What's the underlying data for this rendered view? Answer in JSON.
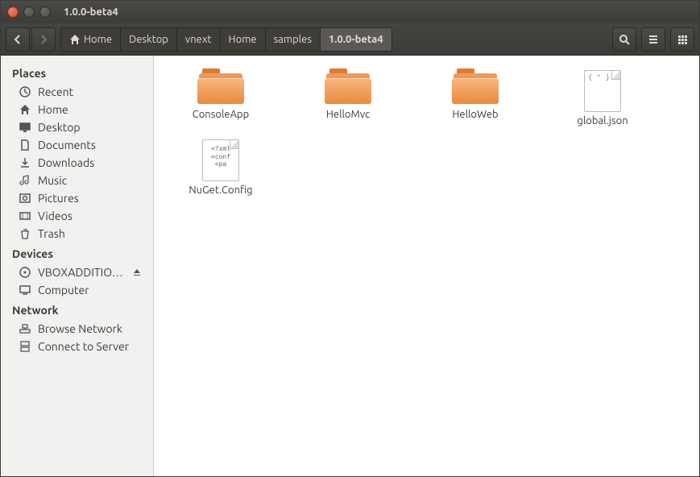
{
  "window": {
    "title": "1.0.0-beta4"
  },
  "breadcrumb": {
    "home_label": "Home",
    "items": [
      "Desktop",
      "vnext",
      "Home",
      "samples",
      "1.0.0-beta4"
    ],
    "active_index": 4
  },
  "sidebar": {
    "sections": [
      {
        "heading": "Places",
        "items": [
          {
            "icon": "recent",
            "label": "Recent"
          },
          {
            "icon": "home",
            "label": "Home"
          },
          {
            "icon": "desktop",
            "label": "Desktop"
          },
          {
            "icon": "documents",
            "label": "Documents"
          },
          {
            "icon": "downloads",
            "label": "Downloads"
          },
          {
            "icon": "music",
            "label": "Music"
          },
          {
            "icon": "pictures",
            "label": "Pictures"
          },
          {
            "icon": "videos",
            "label": "Videos"
          },
          {
            "icon": "trash",
            "label": "Trash"
          }
        ]
      },
      {
        "heading": "Devices",
        "items": [
          {
            "icon": "disc",
            "label": "VBOXADDITIO…",
            "eject": true
          },
          {
            "icon": "computer",
            "label": "Computer"
          }
        ]
      },
      {
        "heading": "Network",
        "items": [
          {
            "icon": "network",
            "label": "Browse Network"
          },
          {
            "icon": "server",
            "label": "Connect to Server"
          }
        ]
      }
    ]
  },
  "files": [
    {
      "type": "folder",
      "name": "ConsoleApp"
    },
    {
      "type": "folder",
      "name": "HelloMvc"
    },
    {
      "type": "folder",
      "name": "HelloWeb"
    },
    {
      "type": "json",
      "name": "global.json",
      "preview": "{\n  \"\n}"
    },
    {
      "type": "xml",
      "name": "NuGet.Config",
      "preview": "<?xml\n<conf\n  <pa"
    }
  ]
}
